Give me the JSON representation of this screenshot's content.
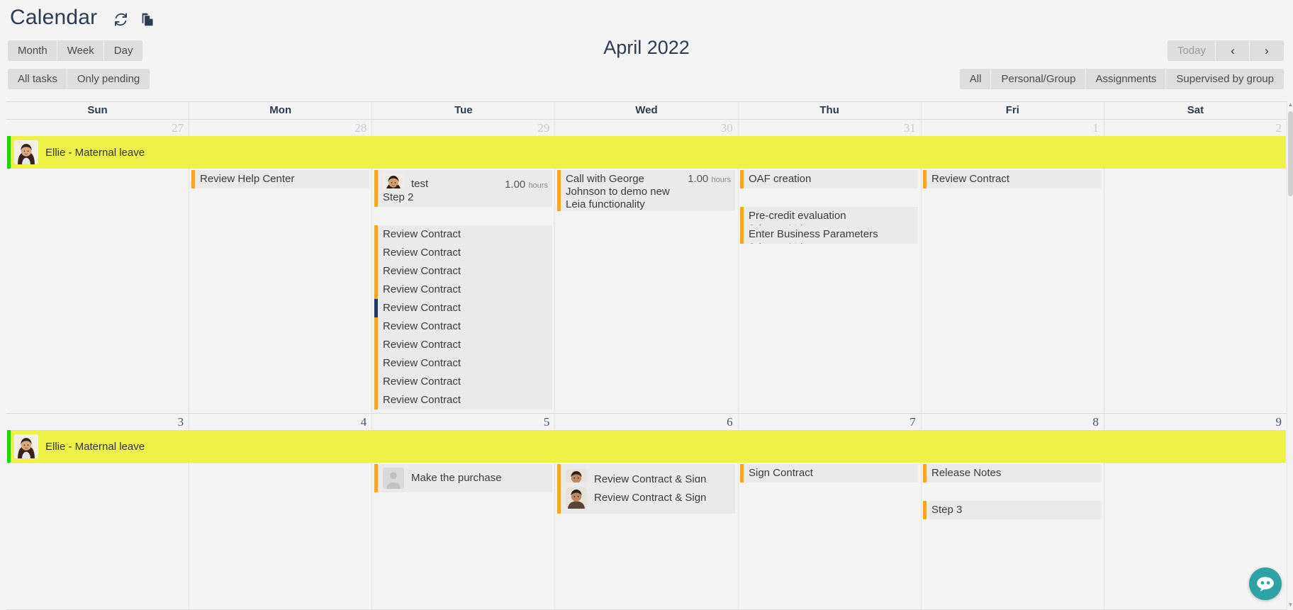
{
  "header": {
    "title": "Calendar",
    "icons": [
      {
        "name": "refresh-icon",
        "label": "refresh"
      },
      {
        "name": "copy-icon",
        "label": "copy"
      }
    ]
  },
  "view_switch": {
    "options": [
      "Month",
      "Week",
      "Day"
    ],
    "selected": "Month"
  },
  "task_filter": {
    "options": [
      "All tasks",
      "Only pending"
    ],
    "selected": "All tasks"
  },
  "navigation": {
    "today_label": "Today",
    "prev_label": "‹",
    "next_label": "›",
    "period_title": "April 2022"
  },
  "scope_filter": {
    "options": [
      "All",
      "Personal/Group",
      "Assignments",
      "Supervised by group"
    ],
    "selected": "All"
  },
  "weekday_headers": [
    "Sun",
    "Mon",
    "Tue",
    "Wed",
    "Thu",
    "Fri",
    "Sat"
  ],
  "colors": {
    "banner_background": "#edf148",
    "banner_accent": "#1fd40a",
    "event_accent": "#f5a623",
    "event_accent_selected": "#1f3864",
    "event_background": "#eaeaea",
    "link_text": "#2b7ec1",
    "page_background": "#f4f4f4",
    "header_text": "#2e3a4d",
    "chat_widget": "#2ea3a5"
  },
  "weeks": [
    {
      "days": [
        {
          "date": "27",
          "in_month": false
        },
        {
          "date": "28",
          "in_month": false
        },
        {
          "date": "29",
          "in_month": false
        },
        {
          "date": "30",
          "in_month": false
        },
        {
          "date": "31",
          "in_month": false
        },
        {
          "date": "1",
          "in_month": false
        },
        {
          "date": "2",
          "in_month": false
        }
      ],
      "banner": {
        "label": "Ellie - Maternal leave",
        "avatar": "woman-dark-hair"
      },
      "events": [
        {
          "day": 1,
          "slot": 0,
          "title": "Review Help Center"
        },
        {
          "day": 2,
          "slot": 0,
          "title": "test",
          "hours": "1.00",
          "hours_unit": "hours",
          "avatar": "woman-long-hair"
        },
        {
          "day": 2,
          "slot": 1,
          "title": "Step 2"
        },
        {
          "day": 2,
          "slot": 3,
          "title": "Review Contract"
        },
        {
          "day": 2,
          "slot": 4,
          "title": "Review Contract"
        },
        {
          "day": 2,
          "slot": 5,
          "title": "Review Contract"
        },
        {
          "day": 2,
          "slot": 6,
          "title": "Review Contract"
        },
        {
          "day": 2,
          "slot": 7,
          "title": "Review Contract",
          "selected": true
        },
        {
          "day": 2,
          "slot": 8,
          "title": "Review Contract"
        },
        {
          "day": 2,
          "slot": 9,
          "title": "Review Contract"
        },
        {
          "day": 2,
          "slot": 10,
          "title": "Review Contract"
        },
        {
          "day": 2,
          "slot": 11,
          "title": "Review Contract"
        },
        {
          "day": 2,
          "slot": 12,
          "title": "Review Contract"
        },
        {
          "day": 3,
          "slot": 0,
          "title": "Call with George Johnson to demo new Leia functionality",
          "hours": "1.00",
          "hours_unit": "hours",
          "tall": true
        },
        {
          "day": 4,
          "slot": 0,
          "title": "OAF creation"
        },
        {
          "day": 4,
          "slot": 2,
          "title": "Pre-credit evaluation",
          "sub": "Johnson Ltd"
        },
        {
          "day": 4,
          "slot": 3,
          "title": "Enter Business Parameters",
          "sub": "Johnson Ltd"
        },
        {
          "day": 5,
          "slot": 0,
          "title": "Review Contract"
        }
      ]
    },
    {
      "days": [
        {
          "date": "3",
          "in_month": true
        },
        {
          "date": "4",
          "in_month": true
        },
        {
          "date": "5",
          "in_month": true
        },
        {
          "date": "6",
          "in_month": true
        },
        {
          "date": "7",
          "in_month": true
        },
        {
          "date": "8",
          "in_month": true
        },
        {
          "date": "9",
          "in_month": true
        }
      ],
      "banner": {
        "label": "Ellie - Maternal leave",
        "avatar": "woman-dark-hair"
      },
      "events": [
        {
          "day": 2,
          "slot": 0,
          "title": "Make the purchase",
          "avatar": "placeholder"
        },
        {
          "day": 3,
          "slot": 0,
          "title": "Review Contract & Sign",
          "avatar": "man-dark-hair",
          "tall2": true
        },
        {
          "day": 3,
          "slot": 1,
          "title": "Review Contract & Sign",
          "avatar": "man-dark-hair",
          "tall2": true
        },
        {
          "day": 4,
          "slot": 0,
          "title": "Sign Contract"
        },
        {
          "day": 5,
          "slot": 0,
          "title": "Release Notes"
        },
        {
          "day": 5,
          "slot": 2,
          "title": "Step 3"
        }
      ]
    }
  ],
  "chat_widget": {
    "name": "chat-support-icon"
  }
}
